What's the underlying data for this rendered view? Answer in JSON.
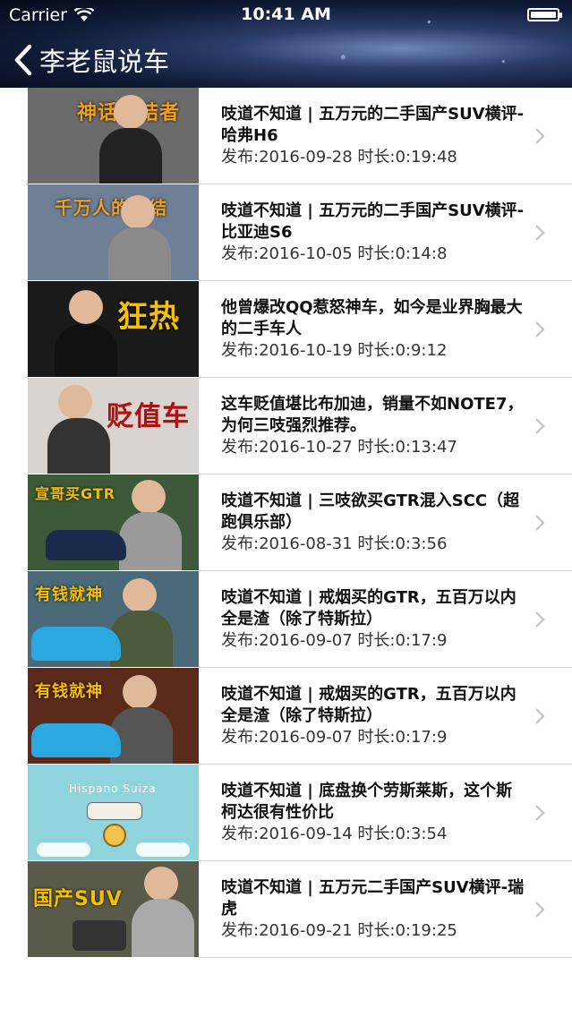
{
  "status_bar": {
    "carrier": "Carrier",
    "time": "10:41 AM"
  },
  "nav": {
    "title": "李老鼠说车"
  },
  "videos": [
    {
      "title": "吱道不知道 | 五万元的二手国产SUV横评-哈弗H6",
      "meta": "发布:2016-09-28 时长:0:19:48"
    },
    {
      "title": "吱道不知道 | 五万元的二手国产SUV横评-比亚迪S6",
      "meta": "发布:2016-10-05 时长:0:14:8"
    },
    {
      "title": "他曾爆改QQ惹怒神车，如今是业界胸最大的二手车人",
      "meta": "发布:2016-10-19 时长:0:9:12"
    },
    {
      "title": "这车贬值堪比布加迪，销量不如NOTE7，为何三吱强烈推荐。",
      "meta": "发布:2016-10-27 时长:0:13:47"
    },
    {
      "title": "吱道不知道 | 三吱欲买GTR混入SCC（超跑俱乐部）",
      "meta": "发布:2016-08-31 时长:0:3:56"
    },
    {
      "title": "吱道不知道 | 戒烟买的GTR，五百万以内全是渣（除了特斯拉）",
      "meta": "发布:2016-09-07 时长:0:17:9"
    },
    {
      "title": "吱道不知道 | 戒烟买的GTR，五百万以内全是渣（除了特斯拉）",
      "meta": "发布:2016-09-07 时长:0:17:9"
    },
    {
      "title": "吱道不知道 | 底盘换个劳斯莱斯，这个斯柯达很有性价比",
      "meta": "发布:2016-09-14 时长:0:3:54"
    },
    {
      "title": "吱道不知道 | 五万元二手国产SUV横评-瑞虎",
      "meta": "发布:2016-09-21 时长:0:19:25"
    }
  ],
  "thumbnails": [
    {
      "caption": "神话终结者",
      "bg": "#6b6b6b",
      "shirt": "#222222"
    },
    {
      "caption": "千万人的终结",
      "bg": "#6f7f95",
      "shirt": "#8a8a8a"
    },
    {
      "caption": "狂热",
      "bg": "#1a1a1a",
      "shirt": "#111111"
    },
    {
      "caption": "贬值车",
      "bg": "#d9d4cf",
      "shirt": "#333333"
    },
    {
      "caption": "宣哥买GTR",
      "bg": "#3c5a3a",
      "shirt": "#9a9a9a"
    },
    {
      "caption": "有钱就神",
      "bg": "#4a6a7a",
      "shirt": "#4a5a3a"
    },
    {
      "caption": "有钱就神",
      "bg": "#5a2a1a",
      "shirt": "#555555"
    },
    {
      "caption": "Hispano Suiza",
      "bg": "#8fd3dc",
      "shirt": "#ffffff"
    },
    {
      "caption": "国产SUV",
      "bg": "#5a5a4a",
      "shirt": "#aaaaaa"
    }
  ]
}
